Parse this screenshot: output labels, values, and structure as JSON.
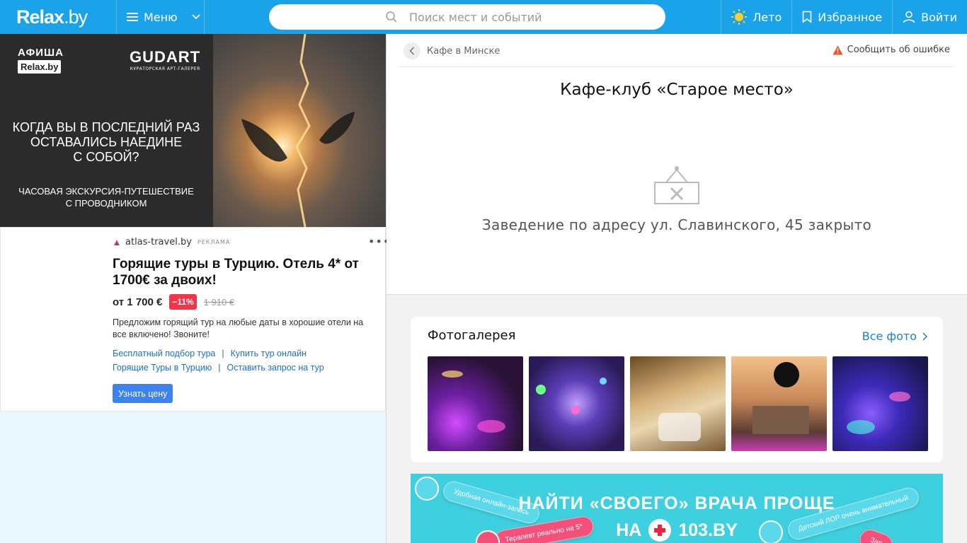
{
  "header": {
    "logo_main": "Relax",
    "logo_suffix": ".by",
    "menu_label": "Меню",
    "search_placeholder": "Поиск мест и событий",
    "season_label": "Лето",
    "favorites_label": "Избранное",
    "login_label": "Войти",
    "colors": {
      "bar": "#1aa3e8"
    }
  },
  "banner": {
    "afisha_word": "АФИША",
    "afisha_brand": "Relax.by",
    "gallery_name": "GUDART",
    "gallery_sub": "КУРАТОРСКАЯ АРТ-ГАЛЕРЕЯ",
    "headline_lines": [
      "КОГДА ВЫ В ПОСЛЕДНИЙ РАЗ",
      "ОСТАВАЛИСЬ НАЕДИНЕ",
      "С СОБОЙ?"
    ],
    "sub_lines": [
      "ЧАСОВАЯ ЭКСКУРСИЯ-ПУТЕШЕСТВИЕ",
      "С ПРОВОДНИКОМ"
    ]
  },
  "ad": {
    "source": "atlas-travel.by",
    "tag": "РЕКЛАМА",
    "more": "•••",
    "title": "Горящие туры в Турцию. Отель 4* от 1700€ за двоих!",
    "price": "от 1 700 €",
    "discount": "−11%",
    "old_price": "1 910 €",
    "text": "Предложим горящий тур на любые даты в хорошие отели на все включено! Звоните!",
    "links": [
      "Бесплатный подбор тура",
      "Купить тур онлайн",
      "Горящие Туры в Турцию",
      "Оставить запрос на тур"
    ],
    "links_sep": "|",
    "button": "Узнать цену"
  },
  "place": {
    "breadcrumb": "Кафе в Минске",
    "report": "Сообщить об ошибке",
    "title": "Кафе-клуб «Старое место»",
    "closed_text": "Заведение по адресу ул. Славинского, 45 закрыто"
  },
  "gallery": {
    "title": "Фотогалерея",
    "all_label": "Все фото",
    "thumbs": [
      "photo-1",
      "photo-2",
      "photo-3",
      "photo-4",
      "photo-5"
    ]
  },
  "promo": {
    "title": "НАЙТИ «СВОЕГО» ВРАЧА ПРОЩЕ",
    "on": "НА",
    "brand": "103.BY",
    "bubbles": [
      "Удобная онлайн-запись",
      "Терапевт реально на 5*",
      "Детский ЛОР очень внимательный",
      "Зап"
    ]
  }
}
